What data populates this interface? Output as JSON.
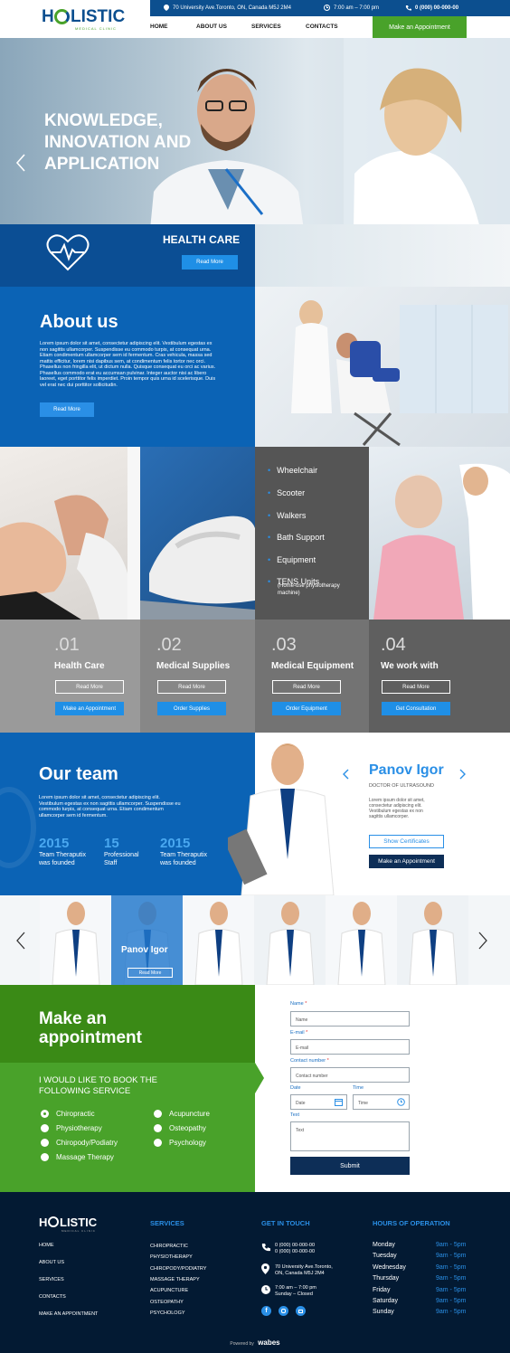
{
  "brand": {
    "logo_text": "H LISTIC",
    "logo_sub": "MEDICAL CLINIC",
    "accent": "#0b63b5",
    "green": "#49a22a",
    "dark": "#031a33"
  },
  "topbar": {
    "address": "70 University Ave.Toronto, ON, Canada M5J 2M4",
    "hours": "7:00 am – 7:00 pm",
    "phone": "0 (000) 00-000-00"
  },
  "nav": {
    "items": [
      "HOME",
      "ABOUT US",
      "SERVICES",
      "CONTACTS"
    ],
    "cta": "Make an Appointment"
  },
  "hero": {
    "line1": "KNOWLEDGE,",
    "line2": "INNOVATION AND",
    "line3": "APPLICATION",
    "badge_title": "HEALTH CARE",
    "badge_button": "Read More"
  },
  "about": {
    "title": "About us",
    "body": "Lorem ipsum dolor sit amet, consectetur adipiscing elit. Vestibulum egestas ex non sagittis ullamcorper. Suspendisse eu commodo turpis, at consequat urna. Etiam condimentum ullamcorper sem id fermentum. Cras vehicula, massa sed mattis efficitur, lorem nisi dapibus sem, at condimentum felis tortor nec orci. Phasellus non fringilla elit, ut dictum nulla. Quisque consequat eu orci ac varius. Phasellus commodo erat eu accumsan pulvinar. Integer auctor nisi ac libero laoreet, eget porttitor felis imperdiet. Proin tempor quis urna id scelerisque. Duis vel erat nec dui porttitor sollicitudin.",
    "button": "Read More"
  },
  "equipment_list": {
    "items": [
      "Wheelchair",
      "Scooter",
      "Walkers",
      "Bath Support",
      "Equipment",
      "TENS Units"
    ],
    "note": "(Home-use physiotherapy machine)"
  },
  "services": [
    {
      "num": ".01",
      "title": "Health Care",
      "more": "Read More",
      "action": "Make an Appointment"
    },
    {
      "num": ".02",
      "title": "Medical Supplies",
      "more": "Read More",
      "action": "Order Supplies"
    },
    {
      "num": ".03",
      "title": "Medical Equipment",
      "more": "Read More",
      "action": "Order Equipment"
    },
    {
      "num": ".04",
      "title": "We work with",
      "more": "Read More",
      "action": "Get Consultation"
    }
  ],
  "team": {
    "title": "Our team",
    "body": "Lorem ipsum dolor sit amet, consectetur adipiscing elit. Vestibulum egestas ex non sagittis ullamcorper. Suspendisse eu commodo turpis, at consequat urna. Etiam condimentum ullamcorper sem id fermentum.",
    "stats": [
      {
        "value": "2015",
        "label1": "Team Theraputix",
        "label2": "was founded"
      },
      {
        "value": "15",
        "label1": "Professional",
        "label2": "Staff"
      },
      {
        "value": "2015",
        "label1": "Team Theraputix",
        "label2": "was founded"
      }
    ],
    "featured": {
      "name": "Panov Igor",
      "role": "DOCTOR OF ULTRASOUND",
      "bio": "Lorem ipsum dolor sit amet, consectetur adipiscing elit. Vestibulum egestas ex non sagittis ullamcorper.",
      "cert": "Show Certificates",
      "book": "Make an Appointment"
    },
    "carousel": {
      "active_name": "Panov Igor",
      "active_button": "Read More"
    }
  },
  "appointment": {
    "title1": "Make an",
    "title2": "appointment",
    "book_label1": "I WOULD LIKE TO BOOK THE",
    "book_label2": "FOLLOWING SERVICE",
    "options": [
      "Chiropractic",
      "Acupuncture",
      "Physiotherapy",
      "Osteopathy",
      "Chiropody/Podiatry",
      "Psychology",
      "Massage Therapy"
    ],
    "form": {
      "name_label": "Name",
      "name_ph": "Name",
      "email_label": "E-mail",
      "email_ph": "E-mail",
      "contact_label": "Contact number",
      "contact_ph": "Contact number",
      "date_label": "Date",
      "date_ph": "Date",
      "time_label": "Time",
      "time_ph": "Time",
      "text_label": "Text",
      "text_ph": "Text",
      "submit": "Submit",
      "required": "*"
    }
  },
  "footer": {
    "links": [
      "HOME",
      "ABOUT US",
      "SERVICES",
      "CONTACTS",
      "MAKE AN APPOINTMENT"
    ],
    "services_title": "SERVICES",
    "services": [
      "CHIROPRACTIC",
      "PHYSIOTHERAPY",
      "CHIROPODY/PODIATRY",
      "MASSAGE THERAPY",
      "ACUPUNCTURE",
      "OSTEOPATHY",
      "PSYCHOLOGY"
    ],
    "contact_title": "GET IN TOUCH",
    "phone1": "0 (000) 00-000-00",
    "phone2": "0 (000) 00-000-00",
    "addr1": "70 University Ave.Toronto,",
    "addr2": "ON, Canada M5J 2M4",
    "hours1": "7:00 am – 7:00 pm",
    "hours2": "Sunday  – Closed",
    "hours_title": "HOURS OF OPERATION",
    "hours": [
      {
        "day": "Monday",
        "time": "9am - 5pm"
      },
      {
        "day": "Tuesday",
        "time": "9am - 5pm"
      },
      {
        "day": "Wednesday",
        "time": "9am - 5pm"
      },
      {
        "day": "Thursday",
        "time": "9am - 5pm"
      },
      {
        "day": "Friday",
        "time": "9am - 5pm"
      },
      {
        "day": "Saturday",
        "time": "9am - 5pm"
      },
      {
        "day": "Sunday",
        "time": "9am - 5pm"
      }
    ],
    "powered": "Powered by",
    "powered_brand": "wabes"
  }
}
